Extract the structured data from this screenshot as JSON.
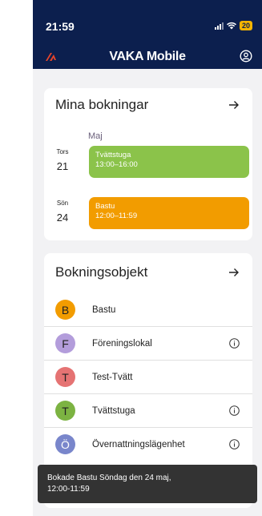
{
  "status_bar": {
    "time": "21:59",
    "battery": "20",
    "icons": [
      "signal-icon",
      "wifi-icon",
      "battery-icon"
    ]
  },
  "app_bar": {
    "title": "VAKA Mobile",
    "logo_icon": "vaka-logo-icon",
    "account_icon": "account-icon"
  },
  "bookings": {
    "title": "Mina bokningar",
    "month": "Maj",
    "items": [
      {
        "dow": "Tors",
        "day": "21",
        "name": "Tvättstuga",
        "time": "13:00–16:00",
        "color": "#8bc34a"
      },
      {
        "dow": "Sön",
        "day": "24",
        "name": "Bastu",
        "time": "12:00–11:59",
        "color": "#f29c00"
      }
    ]
  },
  "objects": {
    "title": "Bokningsobjekt",
    "items": [
      {
        "letter": "B",
        "label": "Bastu",
        "color": "#f29c00",
        "info": false
      },
      {
        "letter": "F",
        "label": "Föreningslokal",
        "color": "#b39ddb",
        "info": true
      },
      {
        "letter": "T",
        "label": "Test-Tvätt",
        "color": "#e57373",
        "info": false
      },
      {
        "letter": "T",
        "label": "Tvättstuga",
        "color": "#7cb342",
        "info": true
      },
      {
        "letter": "Ö",
        "label": "Övernattningslägenhet",
        "color": "#7986cb",
        "info": true
      }
    ]
  },
  "snackbar": {
    "line1": "Bokade Bastu Söndag den 24 maj,",
    "line2": "12:00-11:59"
  },
  "colors": {
    "header": "#0c1f4e",
    "accent": "#e8452a",
    "background": "#f2f2f4"
  }
}
